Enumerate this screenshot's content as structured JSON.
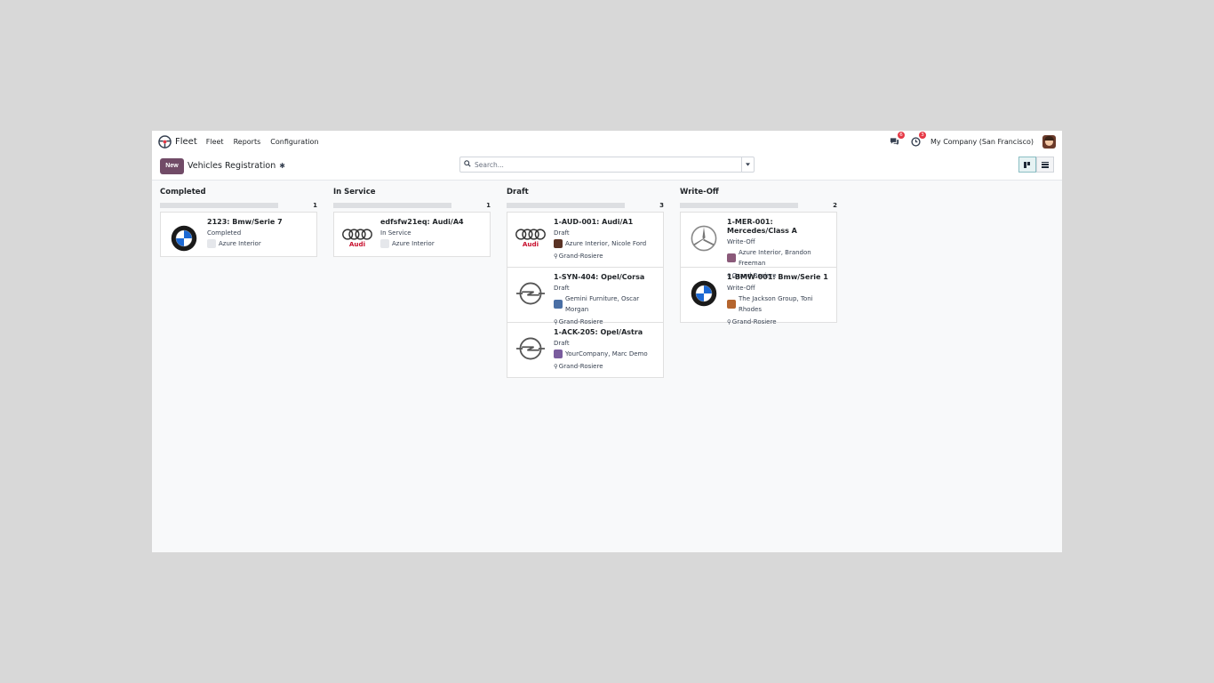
{
  "navbar": {
    "app_name": "Fleet",
    "menu": [
      "Fleet",
      "Reports",
      "Configuration"
    ],
    "messages_count": "6",
    "activities_count": "3",
    "company": "My Company (San Francisco)"
  },
  "control": {
    "new_label": "New",
    "title": "Vehicles Registration",
    "search_placeholder": "Search..."
  },
  "columns": [
    {
      "name": "Completed",
      "count": "1",
      "cards": [
        {
          "title": "2123: Bmw/Serie 7",
          "state": "Completed",
          "driver": "Azure Interior",
          "location": "",
          "logo": "bmw",
          "avatar": "placeholder"
        }
      ]
    },
    {
      "name": "In Service",
      "count": "1",
      "cards": [
        {
          "title": "edfsfw21eq: Audi/A4",
          "state": "In Service",
          "driver": "Azure Interior",
          "location": "",
          "logo": "audi",
          "avatar": "placeholder"
        }
      ]
    },
    {
      "name": "Draft",
      "count": "3",
      "cards": [
        {
          "title": "1-AUD-001: Audi/A1",
          "state": "Draft",
          "driver": "Azure Interior, Nicole Ford",
          "location": "Grand-Rosiere",
          "logo": "audi",
          "avatar": "#5a3325"
        },
        {
          "title": "1-SYN-404: Opel/Corsa",
          "state": "Draft",
          "driver": "Gemini Furniture, Oscar Morgan",
          "location": "Grand-Rosiere",
          "logo": "opel",
          "avatar": "#4a6fa5"
        },
        {
          "title": "1-ACK-205: Opel/Astra",
          "state": "Draft",
          "driver": "YourCompany, Marc Demo",
          "location": "Grand-Rosiere",
          "logo": "opel",
          "avatar": "#7a5c9e"
        }
      ]
    },
    {
      "name": "Write-Off",
      "count": "2",
      "cards": [
        {
          "title": "1-MER-001: Mercedes/Class A",
          "state": "Write-Off",
          "driver": "Azure Interior, Brandon Freeman",
          "location": "Grand-Rosiere",
          "logo": "mercedes",
          "avatar": "#8b5a7a"
        },
        {
          "title": "1-BMW-001: Bmw/Serie 1",
          "state": "Write-Off",
          "driver": "The Jackson Group, Toni Rhodes",
          "location": "Grand-Rosiere",
          "logo": "bmw",
          "avatar": "#b5652e"
        }
      ]
    }
  ]
}
